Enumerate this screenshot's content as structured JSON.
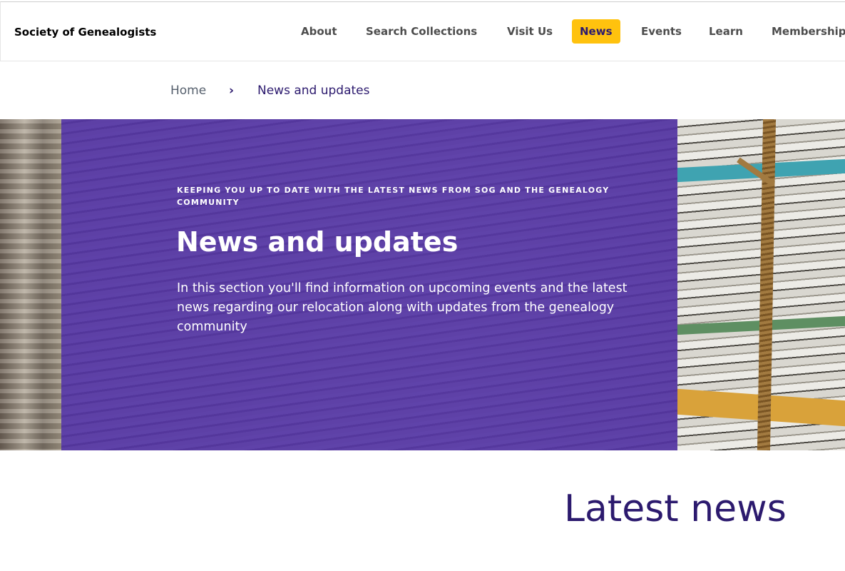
{
  "header": {
    "logo_text": "Society of Genealogists",
    "nav": [
      "About",
      "Search Collections",
      "Visit Us",
      "News",
      "Events",
      "Learn",
      "Membership"
    ],
    "active_nav": "News",
    "accent_color": "#ffc20e"
  },
  "breadcrumb": {
    "home": "Home",
    "separator": "›",
    "current": "News and updates"
  },
  "hero": {
    "eyebrow": "KEEPING YOU UP TO DATE WITH THE LATEST NEWS FROM SOG AND THE GENEALOGY COMMUNITY",
    "title": "News and updates",
    "description": "In this section you'll find information on upcoming events and the latest news regarding our relocation along with updates from the genealogy community",
    "overlay_color": "#4828a0"
  },
  "main": {
    "section_title": "Latest news"
  }
}
